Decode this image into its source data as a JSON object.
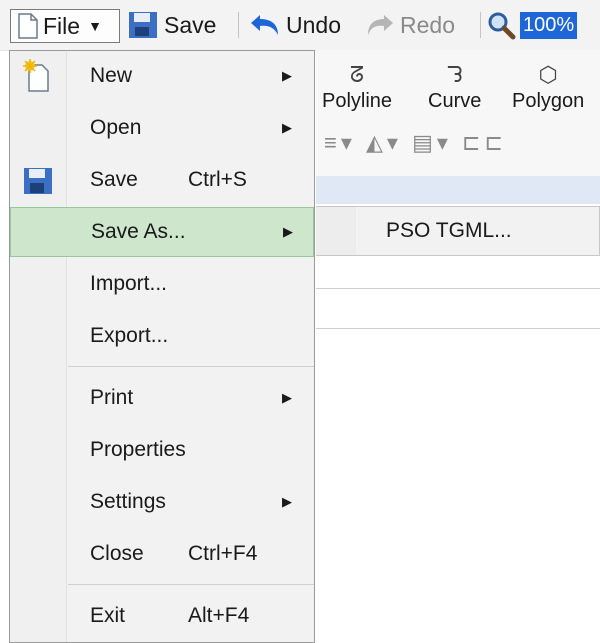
{
  "toolbar": {
    "file_label": "File",
    "save_label": "Save",
    "undo_label": "Undo",
    "redo_label": "Redo",
    "zoom_value": "100%"
  },
  "ribbon": {
    "polyline_label": "Polyline",
    "curve_label": "Curve",
    "polygon_label": "Polygon"
  },
  "file_menu": {
    "new": "New",
    "open": "Open",
    "save": "Save",
    "save_shortcut": "Ctrl+S",
    "save_as": "Save As...",
    "import": "Import...",
    "export": "Export...",
    "print": "Print",
    "properties": "Properties",
    "settings": "Settings",
    "close": "Close",
    "close_shortcut": "Ctrl+F4",
    "exit": "Exit",
    "exit_shortcut": "Alt+F4"
  },
  "save_as_submenu": {
    "pso_tgml": "PSO TGML..."
  },
  "colors": {
    "highlight": "#cde6cc",
    "zoom_accent": "#1e66d8",
    "save_icon": "#3a6fc4"
  },
  "icons": {
    "file": "document-icon",
    "save": "floppy-disk-icon",
    "undo": "undo-arrow-icon",
    "redo": "redo-arrow-icon",
    "zoom": "magnifier-icon",
    "new": "new-document-icon"
  }
}
